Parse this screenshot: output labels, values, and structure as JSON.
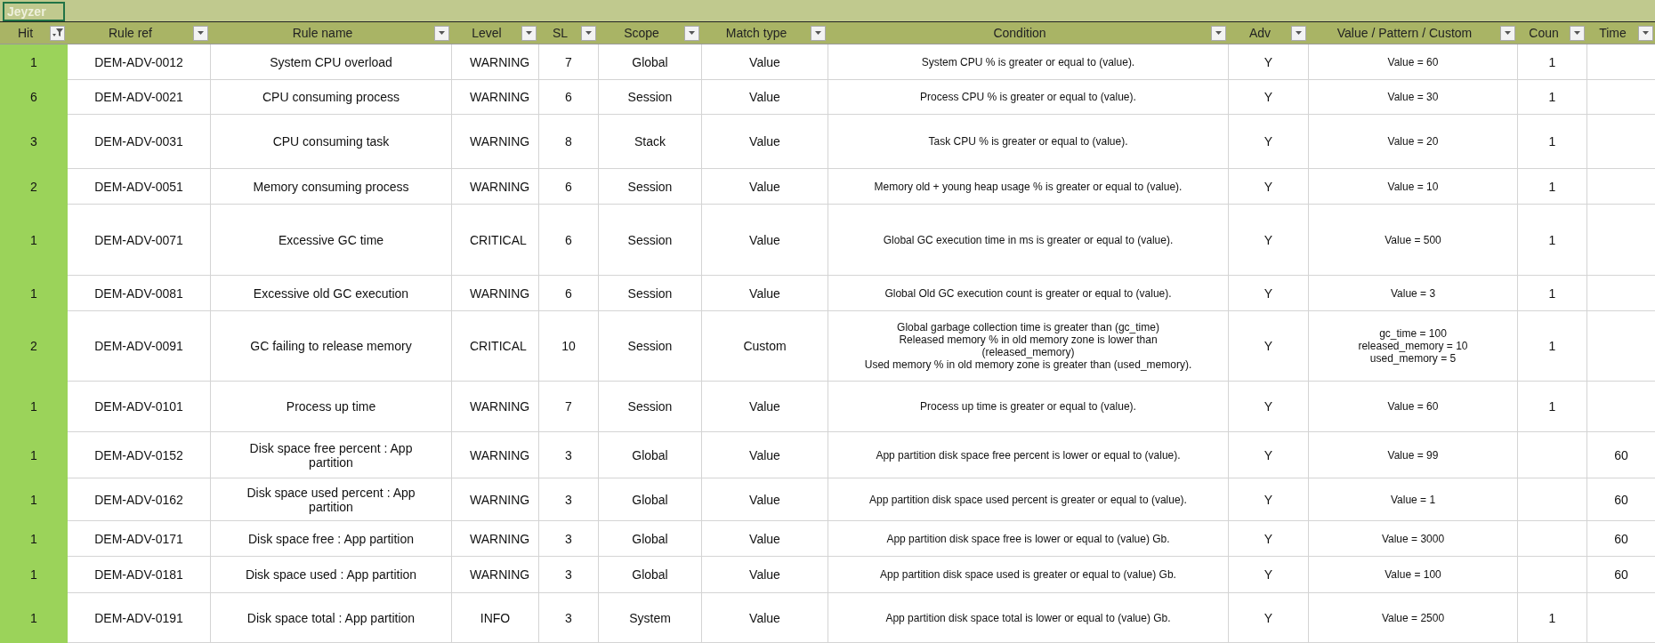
{
  "sheet_title": "Jeyzer",
  "columns": [
    {
      "label": "Hit",
      "filtered": true
    },
    {
      "label": "Rule ref",
      "filtered": false
    },
    {
      "label": "Rule name",
      "filtered": false
    },
    {
      "label": "Level",
      "filtered": false
    },
    {
      "label": "SL",
      "filtered": false
    },
    {
      "label": "Scope",
      "filtered": false
    },
    {
      "label": "Match type",
      "filtered": false
    },
    {
      "label": "Condition",
      "filtered": false
    },
    {
      "label": "Adv",
      "filtered": false
    },
    {
      "label": "Value / Pattern / Custom",
      "filtered": false
    },
    {
      "label": "Coun",
      "filtered": false
    },
    {
      "label": "Time",
      "filtered": false
    }
  ],
  "rows": [
    [
      "1",
      "DEM-ADV-0012",
      "System CPU overload",
      "WARNING",
      "7",
      "Global",
      "Value",
      "System CPU % is greater or equal to (value).",
      "Y",
      "Value = 60",
      "1",
      ""
    ],
    [
      "6",
      "DEM-ADV-0021",
      "CPU consuming process",
      "WARNING",
      "6",
      "Session",
      "Value",
      "Process CPU % is greater or equal to (value).",
      "Y",
      "Value = 30",
      "1",
      ""
    ],
    [
      "3",
      "DEM-ADV-0031",
      "CPU consuming task",
      "WARNING",
      "8",
      "Stack",
      "Value",
      "Task CPU % is greater or equal to (value).",
      "Y",
      "Value = 20",
      "1",
      ""
    ],
    [
      "2",
      "DEM-ADV-0051",
      "Memory consuming process",
      "WARNING",
      "6",
      "Session",
      "Value",
      "Memory old + young heap usage % is greater or equal to (value).",
      "Y",
      "Value = 10",
      "1",
      ""
    ],
    [
      "1",
      "DEM-ADV-0071",
      "Excessive GC time",
      "CRITICAL",
      "6",
      "Session",
      "Value",
      "Global GC execution time in ms is greater or equal to (value).",
      "Y",
      "Value = 500",
      "1",
      ""
    ],
    [
      "1",
      "DEM-ADV-0081",
      "Excessive old GC execution",
      "WARNING",
      "6",
      "Session",
      "Value",
      "Global Old GC execution count is greater or equal to (value).",
      "Y",
      "Value = 3",
      "1",
      ""
    ],
    [
      "2",
      "DEM-ADV-0091",
      "GC failing to release memory",
      "CRITICAL",
      "10",
      "Session",
      "Custom",
      "Global garbage collection time is greater than (gc_time)\nReleased memory % in old memory zone is lower than\n(released_memory)\nUsed memory % in old memory zone is greater than (used_memory).",
      "Y",
      "gc_time = 100\nreleased_memory = 10\nused_memory = 5",
      "1",
      ""
    ],
    [
      "1",
      "DEM-ADV-0101",
      "Process up time",
      "WARNING",
      "7",
      "Session",
      "Value",
      "Process up time is greater or equal to (value).",
      "Y",
      "Value = 60",
      "1",
      ""
    ],
    [
      "1",
      "DEM-ADV-0152",
      "Disk space free percent : App partition",
      "WARNING",
      "3",
      "Global",
      "Value",
      "App partition disk space free percent is lower or equal to (value).",
      "Y",
      "Value = 99",
      "",
      "60"
    ],
    [
      "1",
      "DEM-ADV-0162",
      "Disk space used percent : App partition",
      "WARNING",
      "3",
      "Global",
      "Value",
      "App partition disk space used percent is greater or equal to (value).",
      "Y",
      "Value = 1",
      "",
      "60"
    ],
    [
      "1",
      "DEM-ADV-0171",
      "Disk space free : App partition",
      "WARNING",
      "3",
      "Global",
      "Value",
      "App partition disk space free is lower or equal to (value) Gb.",
      "Y",
      "Value = 3000",
      "",
      "60"
    ],
    [
      "1",
      "DEM-ADV-0181",
      "Disk space used : App partition",
      "WARNING",
      "3",
      "Global",
      "Value",
      "App partition disk space used is greater or equal to (value) Gb.",
      "Y",
      "Value = 100",
      "",
      "60"
    ],
    [
      "1",
      "DEM-ADV-0191",
      "Disk space total : App partition",
      "INFO",
      "3",
      "System",
      "Value",
      "App partition disk space total is lower or equal to (value) Gb.",
      "Y",
      "Value = 2500",
      "1",
      ""
    ]
  ]
}
